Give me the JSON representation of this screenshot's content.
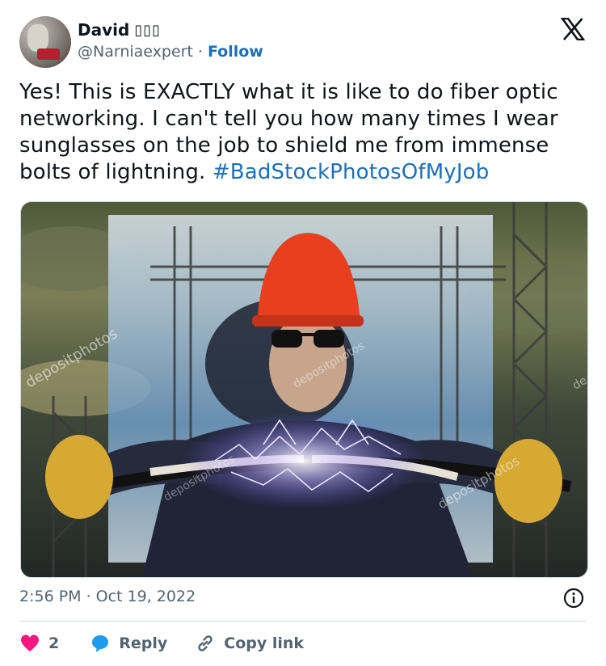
{
  "author": {
    "display_name": "David",
    "name_glyphs": "▯▯▯",
    "handle": "@Narniaexpert",
    "separator": "·",
    "follow_label": "Follow"
  },
  "tweet": {
    "text": "Yes! This is EXACTLY what it is like to do fiber optic\nnetworking. I can't tell you how many times I wear\nsunglasses on the job to shield me from immense\nbolts of lightning. ",
    "hashtag": "#BadStockPhotosOfMyJob"
  },
  "media": {
    "watermark": "depositphotos",
    "watermark_short": "de"
  },
  "meta": {
    "time": "2:56 PM",
    "separator": "·",
    "date": "Oct 19, 2022"
  },
  "actions": {
    "like_count": "2",
    "reply_label": "Reply",
    "copy_link_label": "Copy link"
  },
  "colors": {
    "like_red": "#f91880",
    "reply_blue": "#1d9bf0",
    "link_blue": "#1d6fb8"
  },
  "icons": [
    "x-logo-icon",
    "info-icon",
    "heart-icon",
    "reply-bubble-icon",
    "link-icon"
  ]
}
